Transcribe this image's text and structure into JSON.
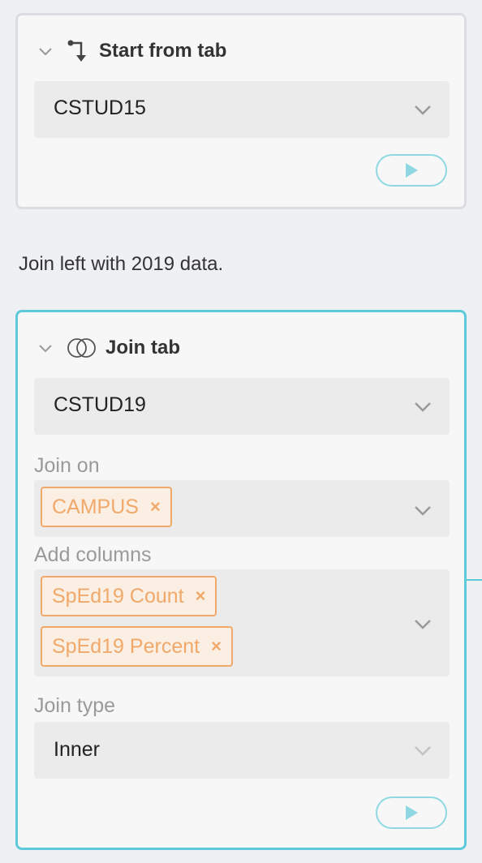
{
  "start_step": {
    "title": "Start from tab",
    "collapse_icon": "chevron-down-icon",
    "step_icon": "start-branch-icon",
    "tab_select": {
      "value": "CSTUD15"
    },
    "run_icon": "play-icon"
  },
  "note": "Join left with 2019 data.",
  "join_step": {
    "title": "Join tab",
    "collapse_icon": "chevron-down-icon",
    "step_icon": "venn-join-icon",
    "tab_select": {
      "value": "CSTUD19"
    },
    "join_on": {
      "label": "Join on",
      "tags": [
        "CAMPUS"
      ]
    },
    "add_columns": {
      "label": "Add columns",
      "tags": [
        "SpEd19 Count",
        "SpEd19 Percent"
      ]
    },
    "join_type": {
      "label": "Join type",
      "value": "Inner"
    },
    "tag_remove_glyph": "×",
    "run_icon": "play-icon"
  },
  "colors": {
    "accent": "#5ec9d8",
    "tag": "#f0a96a",
    "card_border": "#dcdde1"
  }
}
